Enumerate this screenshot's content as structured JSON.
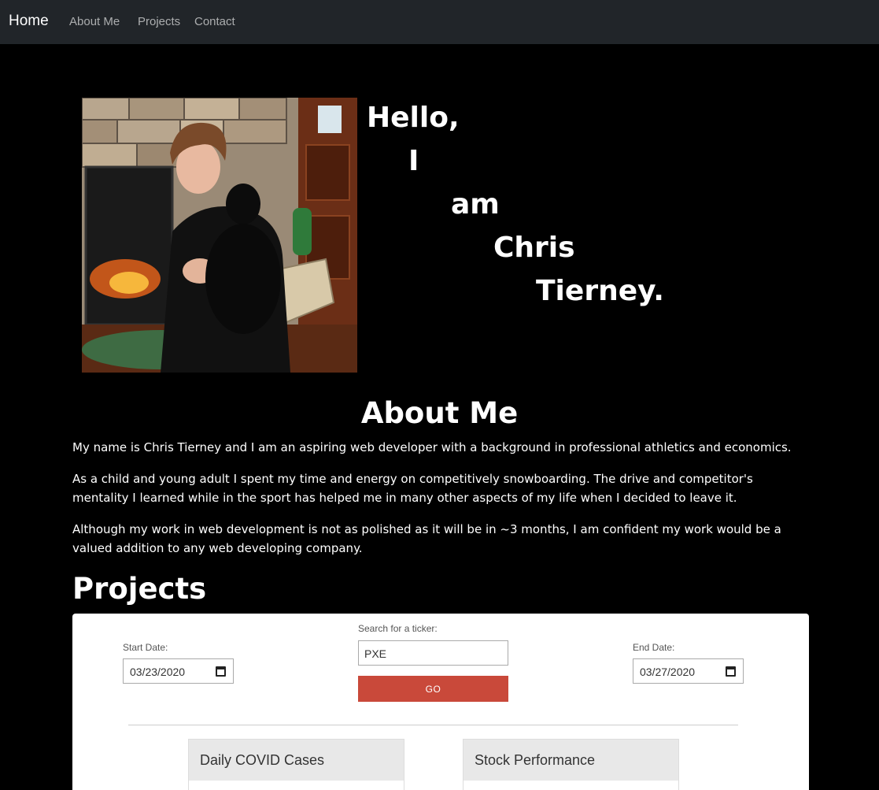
{
  "nav": {
    "brand": "Home",
    "links": [
      "About Me",
      "Projects",
      "Contact"
    ]
  },
  "hero": {
    "words": [
      "Hello,",
      "I",
      "am",
      "Chris",
      "Tierney."
    ]
  },
  "about": {
    "title": "About Me",
    "paragraphs": [
      "My name is Chris Tierney and I am an aspiring web developer with a background in professional athletics and economics.",
      "As a child and young adult I spent my time and energy on competitively snowboarding. The drive and competitor's mentality I learned while in the sport has helped me in many other aspects of my life when I decided to leave it.",
      "Although my work in web development is not as polished as it will be in ~3 months, I am confident my work would be a valued addition to any web developing company."
    ]
  },
  "projects": {
    "title": "Projects",
    "start_label": "Start Date:",
    "start_value": "03/23/2020",
    "ticker_label": "Search for a ticker:",
    "ticker_value": "PXE",
    "go_label": "GO",
    "end_label": "End Date:",
    "end_value": "03/27/2020",
    "panels": [
      "Daily COVID Cases",
      "Stock Performance"
    ]
  },
  "colors": {
    "navbar": "#212529",
    "background": "#000000",
    "go_button": "#c9493a"
  }
}
